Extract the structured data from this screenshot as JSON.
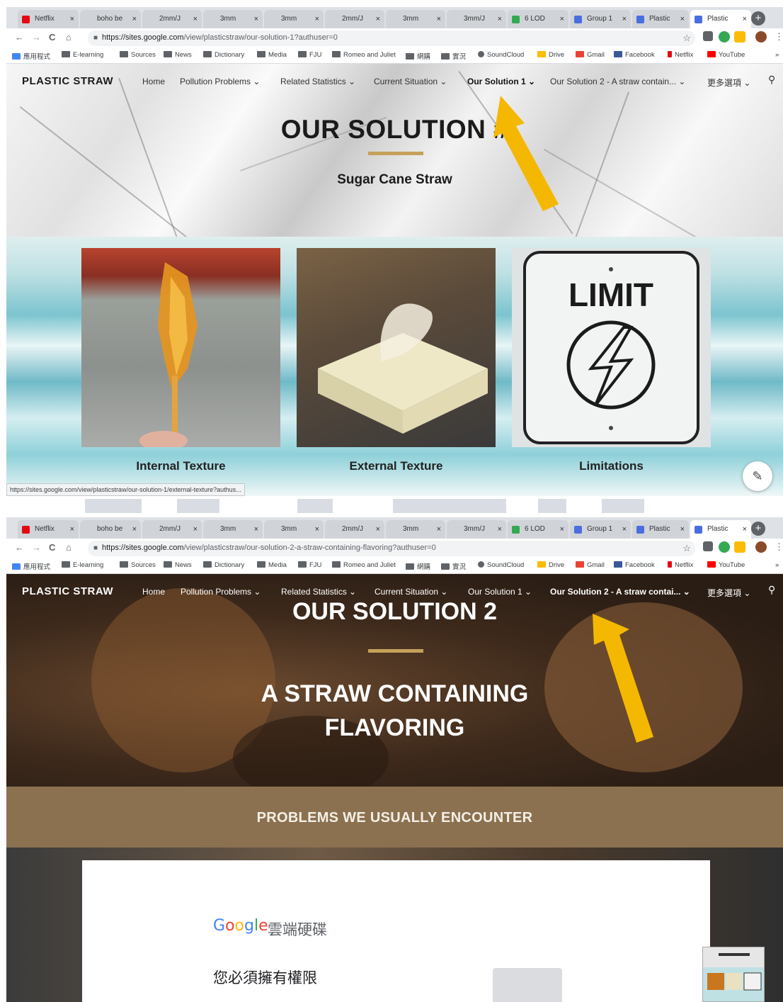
{
  "browser": {
    "tabs": [
      "Netflix",
      "boho be",
      "2mm/J",
      "3mm",
      "3mm",
      "2mm/J",
      "3mm",
      "3mm/J",
      "6 LOD",
      "Group 1",
      "Plastic",
      "Plastic"
    ],
    "tab_close": "×",
    "new_tab": "+",
    "bookmarks": [
      "應用程式",
      "E-learning",
      "Sources",
      "News",
      "Dictionary",
      "Media",
      "FJU",
      "Romeo and Juliet",
      "網購",
      "實況",
      "SoundCloud",
      "Drive",
      "Gmail",
      "Facebook",
      "Netflix",
      "YouTube"
    ],
    "more_bookmarks": "»"
  },
  "nav_glyphs": {
    "back": "←",
    "forward": "→",
    "reload": "C",
    "home": "⌂",
    "star": "☆",
    "lock": "🔒",
    "search": "⚲",
    "edit": "✎"
  },
  "screenshot1": {
    "url_domain": "https://sites.google.com",
    "url_path": "/view/plasticstraw/our-solution-1?authuser=0",
    "site_title": "PLASTIC STRAW",
    "nav": [
      "Home",
      "Pollution Problems ⌄",
      "Related Statistics ⌄",
      "Current Situation ⌄",
      "Our Solution 1 ⌄",
      "Our Solution 2 - A straw contain... ⌄",
      "更多選項 ⌄"
    ],
    "hero_title": "OUR SOLUTION #",
    "hero_subtitle": "Sugar Cane Straw",
    "cards": [
      "Internal Texture",
      "External Texture",
      "Limitations"
    ],
    "limit_sign_text": "LIMIT",
    "status_url": "https://sites.google.com/view/plasticstraw/our-solution-1/external-texture?authus..."
  },
  "screenshot2": {
    "url_domain": "https://sites.google.com",
    "url_path": "/view/plasticstraw/our-solution-2-a-straw-containing-flavoring?authuser=0",
    "site_title": "PLASTIC STRAW",
    "nav": [
      "Home",
      "Pollution Problems ⌄",
      "Related Statistics ⌄",
      "Current Situation ⌄",
      "Our Solution 1 ⌄",
      "Our Solution 2 - A straw contai... ⌄",
      "更多選項 ⌄"
    ],
    "hero_title": "OUR SOLUTION 2",
    "hero_line2": "A STRAW CONTAINING",
    "hero_line3": "FLAVORING",
    "section_title": "PROBLEMS WE USUALLY ENCOUNTER",
    "google_logo_letters": [
      "G",
      "o",
      "o",
      "g",
      "l",
      "e"
    ],
    "drive_product": "雲端硬碟",
    "permission_text": "您必須擁有權限"
  },
  "colors": {
    "gold": "#c6a15b",
    "arrow": "#f5b800",
    "band": "#8b7150",
    "google": [
      "#4285f4",
      "#ea4335",
      "#fbbc05",
      "#4285f4",
      "#34a853",
      "#ea4335"
    ]
  }
}
